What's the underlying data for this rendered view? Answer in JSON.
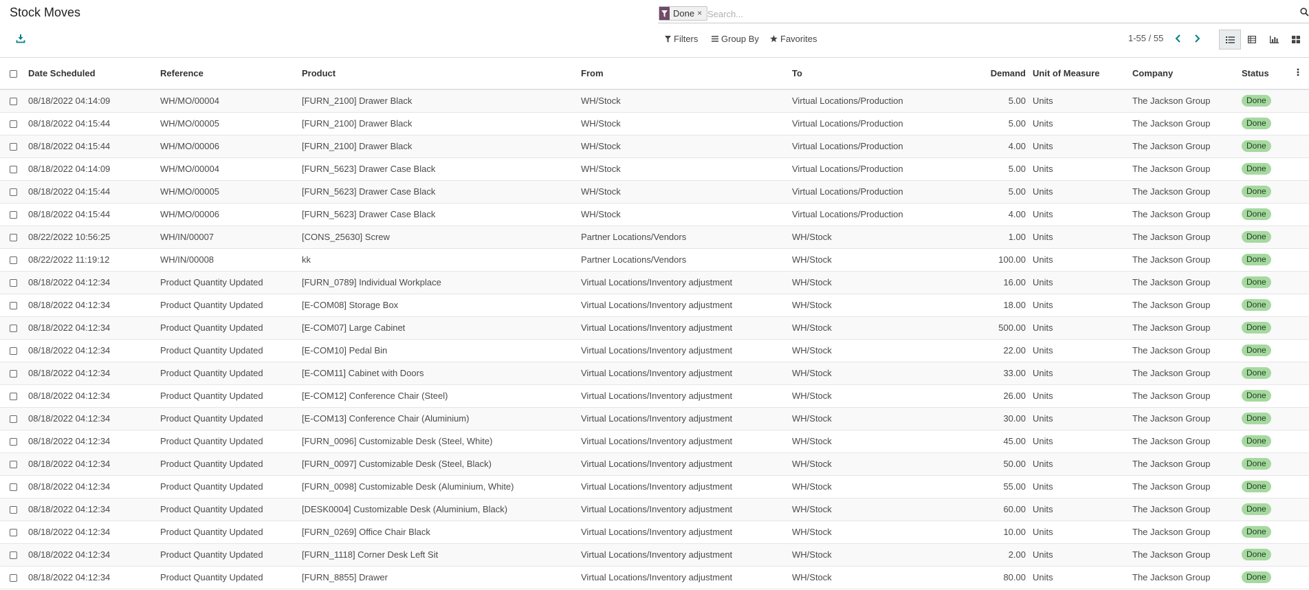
{
  "page_title": "Stock Moves",
  "search": {
    "facet_value": "Done",
    "facet_remove": "×",
    "placeholder": "Search..."
  },
  "toolbar": {
    "filters_label": "Filters",
    "group_by_label": "Group By",
    "favorites_label": "Favorites"
  },
  "pager": {
    "range": "1-55 / 55"
  },
  "colors": {
    "accent": "#714b67",
    "badge_bg": "#a6d9a0"
  },
  "table": {
    "headers": {
      "date": "Date Scheduled",
      "reference": "Reference",
      "product": "Product",
      "from": "From",
      "to": "To",
      "demand": "Demand",
      "uom": "Unit of Measure",
      "company": "Company",
      "status": "Status"
    },
    "rows": [
      {
        "date": "08/18/2022 04:14:09",
        "reference": "WH/MO/00004",
        "product": "[FURN_2100] Drawer Black",
        "from": "WH/Stock",
        "to": "Virtual Locations/Production",
        "demand": "5.00",
        "uom": "Units",
        "company": "The Jackson Group",
        "status": "Done"
      },
      {
        "date": "08/18/2022 04:15:44",
        "reference": "WH/MO/00005",
        "product": "[FURN_2100] Drawer Black",
        "from": "WH/Stock",
        "to": "Virtual Locations/Production",
        "demand": "5.00",
        "uom": "Units",
        "company": "The Jackson Group",
        "status": "Done"
      },
      {
        "date": "08/18/2022 04:15:44",
        "reference": "WH/MO/00006",
        "product": "[FURN_2100] Drawer Black",
        "from": "WH/Stock",
        "to": "Virtual Locations/Production",
        "demand": "4.00",
        "uom": "Units",
        "company": "The Jackson Group",
        "status": "Done"
      },
      {
        "date": "08/18/2022 04:14:09",
        "reference": "WH/MO/00004",
        "product": "[FURN_5623] Drawer Case Black",
        "from": "WH/Stock",
        "to": "Virtual Locations/Production",
        "demand": "5.00",
        "uom": "Units",
        "company": "The Jackson Group",
        "status": "Done"
      },
      {
        "date": "08/18/2022 04:15:44",
        "reference": "WH/MO/00005",
        "product": "[FURN_5623] Drawer Case Black",
        "from": "WH/Stock",
        "to": "Virtual Locations/Production",
        "demand": "5.00",
        "uom": "Units",
        "company": "The Jackson Group",
        "status": "Done"
      },
      {
        "date": "08/18/2022 04:15:44",
        "reference": "WH/MO/00006",
        "product": "[FURN_5623] Drawer Case Black",
        "from": "WH/Stock",
        "to": "Virtual Locations/Production",
        "demand": "4.00",
        "uom": "Units",
        "company": "The Jackson Group",
        "status": "Done"
      },
      {
        "date": "08/22/2022 10:56:25",
        "reference": "WH/IN/00007",
        "product": "[CONS_25630] Screw",
        "from": "Partner Locations/Vendors",
        "to": "WH/Stock",
        "demand": "1.00",
        "uom": "Units",
        "company": "The Jackson Group",
        "status": "Done"
      },
      {
        "date": "08/22/2022 11:19:12",
        "reference": "WH/IN/00008",
        "product": "kk",
        "from": "Partner Locations/Vendors",
        "to": "WH/Stock",
        "demand": "100.00",
        "uom": "Units",
        "company": "The Jackson Group",
        "status": "Done"
      },
      {
        "date": "08/18/2022 04:12:34",
        "reference": "Product Quantity Updated",
        "product": "[FURN_0789] Individual Workplace",
        "from": "Virtual Locations/Inventory adjustment",
        "to": "WH/Stock",
        "demand": "16.00",
        "uom": "Units",
        "company": "The Jackson Group",
        "status": "Done"
      },
      {
        "date": "08/18/2022 04:12:34",
        "reference": "Product Quantity Updated",
        "product": "[E-COM08] Storage Box",
        "from": "Virtual Locations/Inventory adjustment",
        "to": "WH/Stock",
        "demand": "18.00",
        "uom": "Units",
        "company": "The Jackson Group",
        "status": "Done"
      },
      {
        "date": "08/18/2022 04:12:34",
        "reference": "Product Quantity Updated",
        "product": "[E-COM07] Large Cabinet",
        "from": "Virtual Locations/Inventory adjustment",
        "to": "WH/Stock",
        "demand": "500.00",
        "uom": "Units",
        "company": "The Jackson Group",
        "status": "Done"
      },
      {
        "date": "08/18/2022 04:12:34",
        "reference": "Product Quantity Updated",
        "product": "[E-COM10] Pedal Bin",
        "from": "Virtual Locations/Inventory adjustment",
        "to": "WH/Stock",
        "demand": "22.00",
        "uom": "Units",
        "company": "The Jackson Group",
        "status": "Done"
      },
      {
        "date": "08/18/2022 04:12:34",
        "reference": "Product Quantity Updated",
        "product": "[E-COM11] Cabinet with Doors",
        "from": "Virtual Locations/Inventory adjustment",
        "to": "WH/Stock",
        "demand": "33.00",
        "uom": "Units",
        "company": "The Jackson Group",
        "status": "Done"
      },
      {
        "date": "08/18/2022 04:12:34",
        "reference": "Product Quantity Updated",
        "product": "[E-COM12] Conference Chair (Steel)",
        "from": "Virtual Locations/Inventory adjustment",
        "to": "WH/Stock",
        "demand": "26.00",
        "uom": "Units",
        "company": "The Jackson Group",
        "status": "Done"
      },
      {
        "date": "08/18/2022 04:12:34",
        "reference": "Product Quantity Updated",
        "product": "[E-COM13] Conference Chair (Aluminium)",
        "from": "Virtual Locations/Inventory adjustment",
        "to": "WH/Stock",
        "demand": "30.00",
        "uom": "Units",
        "company": "The Jackson Group",
        "status": "Done"
      },
      {
        "date": "08/18/2022 04:12:34",
        "reference": "Product Quantity Updated",
        "product": "[FURN_0096] Customizable Desk (Steel, White)",
        "from": "Virtual Locations/Inventory adjustment",
        "to": "WH/Stock",
        "demand": "45.00",
        "uom": "Units",
        "company": "The Jackson Group",
        "status": "Done"
      },
      {
        "date": "08/18/2022 04:12:34",
        "reference": "Product Quantity Updated",
        "product": "[FURN_0097] Customizable Desk (Steel, Black)",
        "from": "Virtual Locations/Inventory adjustment",
        "to": "WH/Stock",
        "demand": "50.00",
        "uom": "Units",
        "company": "The Jackson Group",
        "status": "Done"
      },
      {
        "date": "08/18/2022 04:12:34",
        "reference": "Product Quantity Updated",
        "product": "[FURN_0098] Customizable Desk (Aluminium, White)",
        "from": "Virtual Locations/Inventory adjustment",
        "to": "WH/Stock",
        "demand": "55.00",
        "uom": "Units",
        "company": "The Jackson Group",
        "status": "Done"
      },
      {
        "date": "08/18/2022 04:12:34",
        "reference": "Product Quantity Updated",
        "product": "[DESK0004] Customizable Desk (Aluminium, Black)",
        "from": "Virtual Locations/Inventory adjustment",
        "to": "WH/Stock",
        "demand": "60.00",
        "uom": "Units",
        "company": "The Jackson Group",
        "status": "Done"
      },
      {
        "date": "08/18/2022 04:12:34",
        "reference": "Product Quantity Updated",
        "product": "[FURN_0269] Office Chair Black",
        "from": "Virtual Locations/Inventory adjustment",
        "to": "WH/Stock",
        "demand": "10.00",
        "uom": "Units",
        "company": "The Jackson Group",
        "status": "Done"
      },
      {
        "date": "08/18/2022 04:12:34",
        "reference": "Product Quantity Updated",
        "product": "[FURN_1118] Corner Desk Left Sit",
        "from": "Virtual Locations/Inventory adjustment",
        "to": "WH/Stock",
        "demand": "2.00",
        "uom": "Units",
        "company": "The Jackson Group",
        "status": "Done"
      },
      {
        "date": "08/18/2022 04:12:34",
        "reference": "Product Quantity Updated",
        "product": "[FURN_8855] Drawer",
        "from": "Virtual Locations/Inventory adjustment",
        "to": "WH/Stock",
        "demand": "80.00",
        "uom": "Units",
        "company": "The Jackson Group",
        "status": "Done"
      }
    ]
  }
}
